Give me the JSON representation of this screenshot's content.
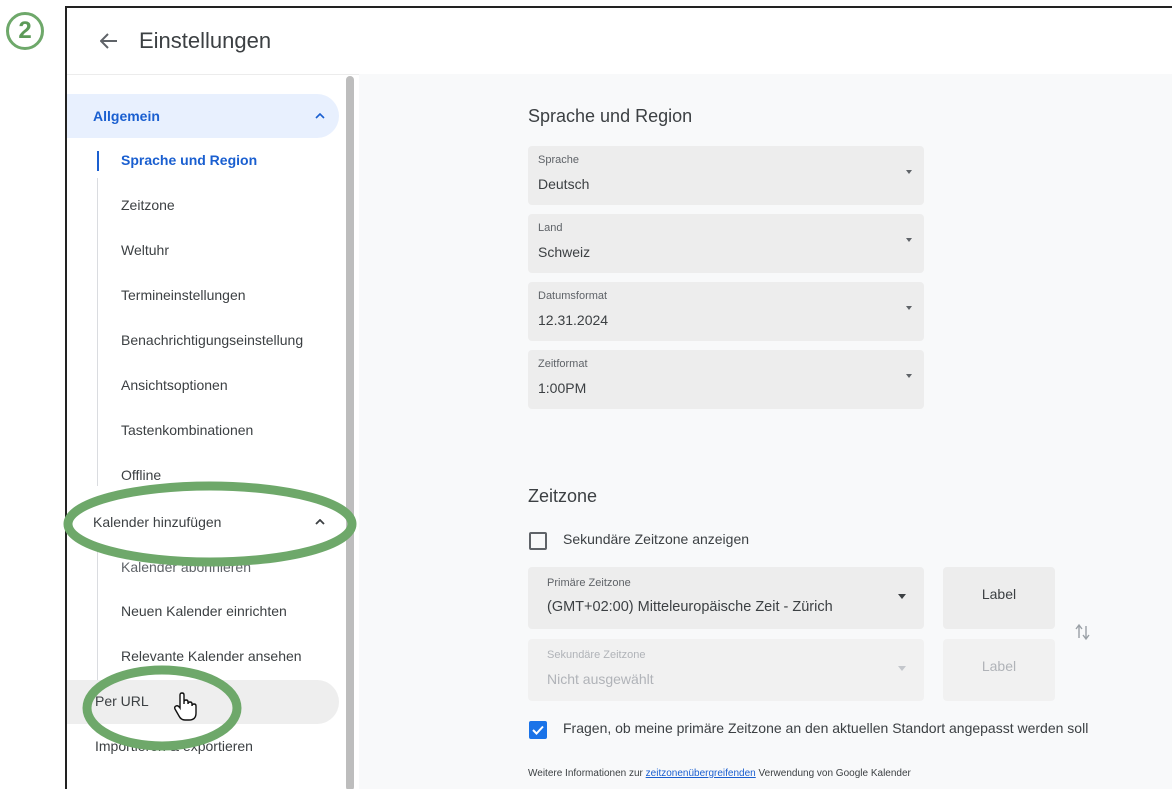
{
  "step_badge": "2",
  "header": {
    "title": "Einstellungen",
    "back_icon": "arrow-back-icon"
  },
  "sidebar": {
    "group_general": "Allgemein",
    "general_items": [
      "Sprache und Region",
      "Zeitzone",
      "Weltuhr",
      "Termineinstellungen",
      "Benachrichtigungseinstellung",
      "Ansichtsoptionen",
      "Tastenkombinationen",
      "Offline"
    ],
    "group_add_calendar": "Kalender hinzufügen",
    "add_calendar_items": [
      "Kalender abonnieren",
      "Neuen Kalender einrichten",
      "Relevante Kalender ansehen",
      "Per URL",
      "Importieren & exportieren"
    ]
  },
  "language_region": {
    "title": "Sprache und Region",
    "fields": [
      {
        "label": "Sprache",
        "value": "Deutsch"
      },
      {
        "label": "Land",
        "value": "Schweiz"
      },
      {
        "label": "Datumsformat",
        "value": "12.31.2024"
      },
      {
        "label": "Zeitformat",
        "value": "1:00PM"
      }
    ]
  },
  "timezone": {
    "title": "Zeitzone",
    "secondary_checkbox_label": "Sekundäre Zeitzone anzeigen",
    "secondary_checkbox_checked": false,
    "primary": {
      "label": "Primäre Zeitzone",
      "value": "(GMT+02:00) Mitteleuropäische Zeit - Zürich",
      "side_label": "Label"
    },
    "secondary": {
      "label": "Sekundäre Zeitzone",
      "value": "Nicht ausgewählt",
      "side_label": "Label"
    },
    "ask_checkbox_label": "Fragen, ob meine primäre Zeitzone an den aktuellen Standort angepasst werden soll",
    "ask_checkbox_checked": true,
    "info_prefix": "Weitere Informationen zur",
    "info_link": "zeitzonenübergreifenden",
    "info_suffix": "Verwendung von Google Kalender"
  },
  "colors": {
    "accent": "#1a73e8",
    "highlight_ring": "#5c9a58",
    "active_nav_bg": "#e8f0fe"
  }
}
